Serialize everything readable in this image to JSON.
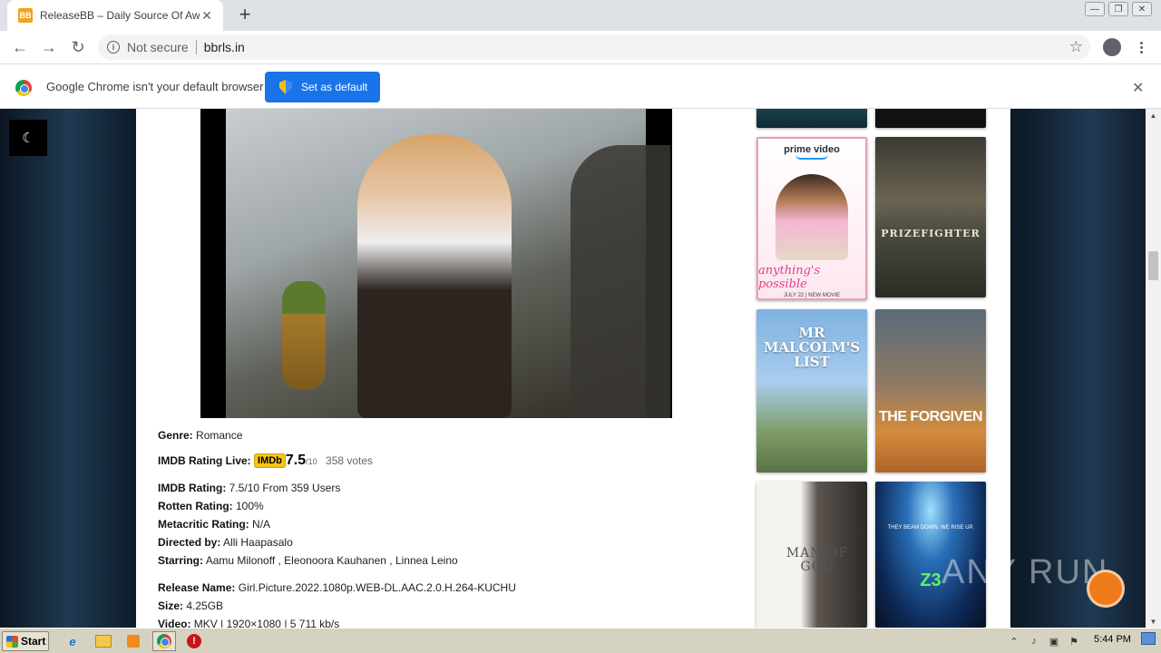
{
  "browser": {
    "tab_title": "ReleaseBB – Daily Source Of Awesome",
    "tab_favicon": "BB",
    "new_tab_label": "+",
    "security_label": "Not secure",
    "url": "bbrls.in"
  },
  "infobar": {
    "message": "Google Chrome isn't your default browser",
    "button_label": "Set as default",
    "close_label": "✕"
  },
  "page": {
    "movie": {
      "genre_label": "Genre:",
      "genre": "Romance",
      "imdb_live_label": "IMDB Rating Live:",
      "imdb_badge": "IMDb",
      "imdb_live_score": "7.5",
      "imdb_live_out_of": "/10",
      "imdb_live_votes": "358 votes",
      "imdb_rating_label": "IMDB Rating:",
      "imdb_rating": "7.5/10 From 359 Users",
      "rotten_label": "Rotten Rating:",
      "rotten": "100%",
      "metacritic_label": "Metacritic Rating:",
      "metacritic": "N/A",
      "director_label": "Directed by:",
      "director": "Alli Haapasalo",
      "starring_label": "Starring:",
      "starring": "Aamu Milonoff , Eleonoora Kauhanen , Linnea Leino",
      "release_name_label": "Release Name:",
      "release_name": "Girl.Picture.2022.1080p.WEB-DL.AAC.2.0.H.264-KUCHU",
      "size_label": "Size:",
      "size": "4.25GB",
      "video_label": "Video:",
      "video": "MKV | 1920×1080 | 5 711 kb/s"
    },
    "sidebar_posters": [
      {
        "brand": "prime video",
        "title": "anything's possible",
        "sub": "JULY 22 | NEW MOVIE"
      },
      {
        "title": "PRIZEFIGHTER"
      },
      {
        "title": "MR MALCOLM'S LIST"
      },
      {
        "title": "THE FORGIVEN"
      },
      {
        "title": "MAN OF GOD"
      },
      {
        "tagline": "THEY BEAM DOWN. WE RISE UP.",
        "title": "Z3"
      }
    ],
    "watermark": "ANY RUN"
  },
  "taskbar": {
    "start_label": "Start",
    "clock": "5:44 PM"
  }
}
